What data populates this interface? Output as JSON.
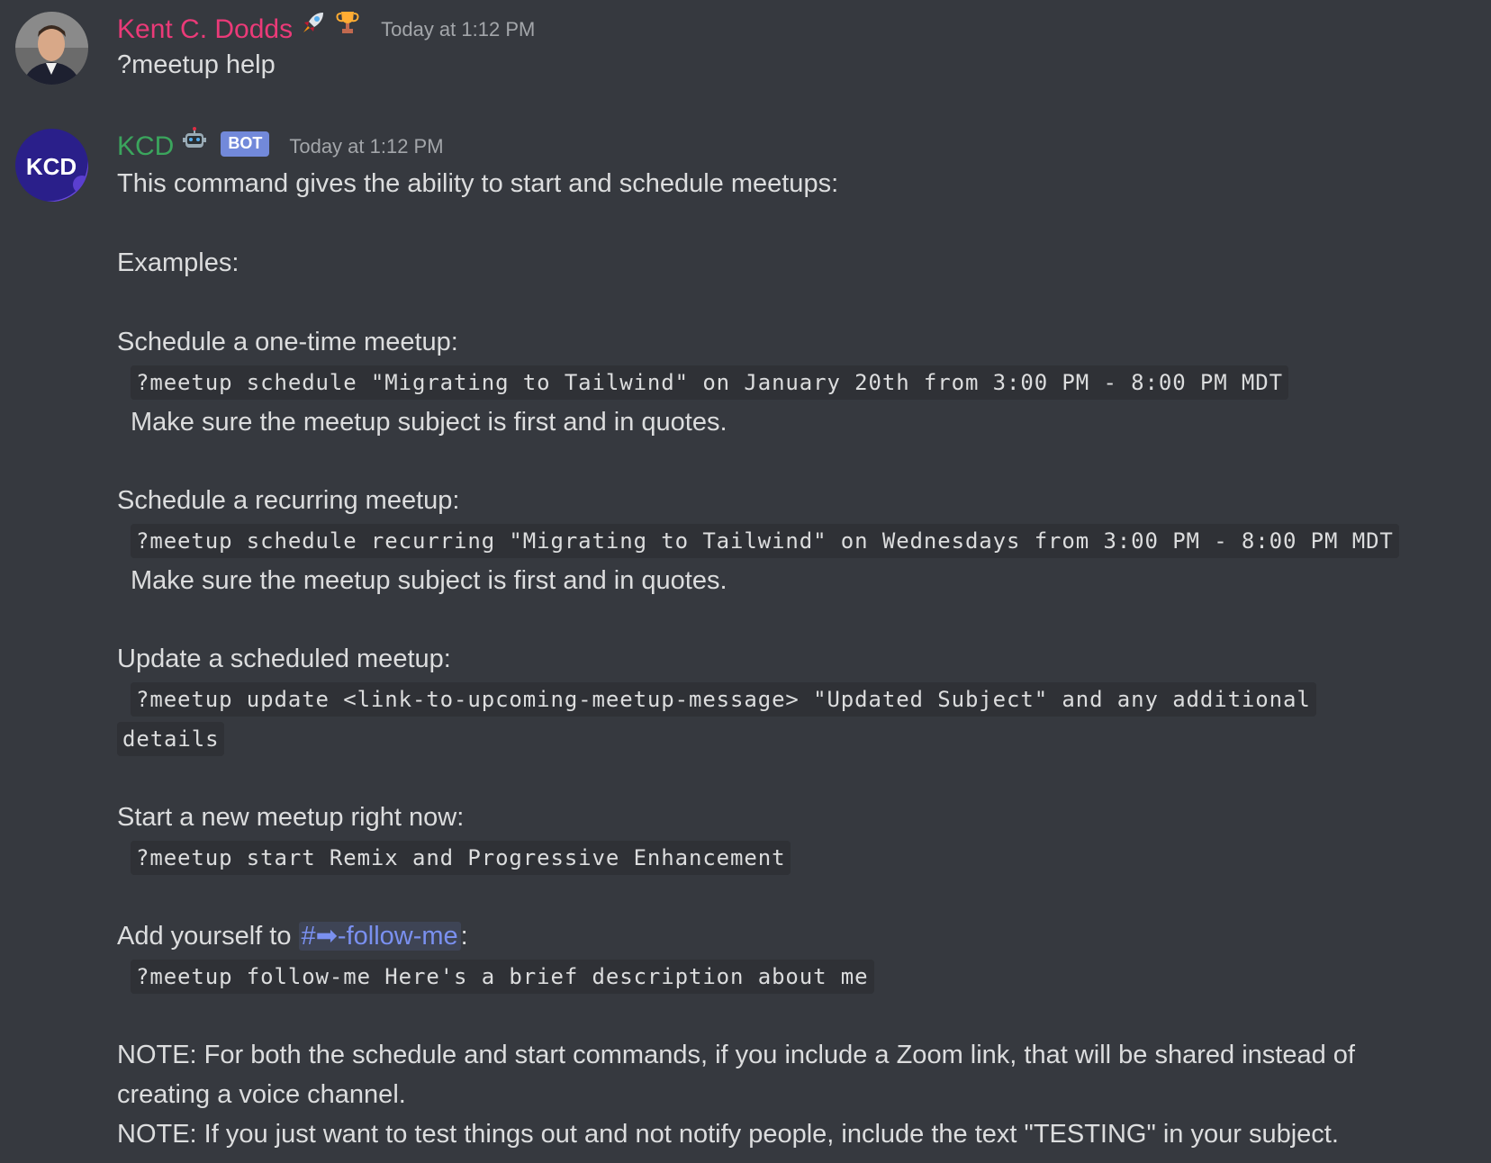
{
  "messages": [
    {
      "author": "Kent C. Dodds",
      "author_emojis": [
        "rocket-emoji",
        "trophy-emoji"
      ],
      "timestamp": "Today at 1:12 PM",
      "text": "?meetup help"
    },
    {
      "author": "KCD",
      "author_emoji": "robot-emoji",
      "bot_tag": "BOT",
      "timestamp": "Today at 1:12 PM",
      "avatar_text": "KCD",
      "intro": "This command gives the ability to start and schedule meetups:",
      "examples_label": "Examples:",
      "sections": [
        {
          "title": "Schedule a one-time meetup:",
          "code": "?meetup schedule \"Migrating to Tailwind\" on January 20th from 3:00 PM - 8:00 PM MDT",
          "note": "Make sure the meetup subject is first and in quotes."
        },
        {
          "title": "Schedule a recurring meetup:",
          "code": "?meetup schedule recurring \"Migrating to Tailwind\" on Wednesdays from 3:00 PM - 8:00 PM MDT",
          "note": "Make sure the meetup subject is first and in quotes."
        },
        {
          "title": "Update a scheduled meetup:",
          "code_line1": "?meetup update <link-to-upcoming-meetup-message> \"Updated Subject\" and any additional",
          "code_line2": "details"
        },
        {
          "title": "Start a new meetup right now:",
          "code": "?meetup start Remix and Progressive Enhancement"
        },
        {
          "title_prefix": "Add yourself to ",
          "channel_mention": "#➡-follow-me",
          "title_suffix": ":",
          "code": "?meetup follow-me Here's a brief description about me"
        }
      ],
      "note1_line1": "NOTE: For both the schedule and start commands, if you include a Zoom link, that will be shared instead of",
      "note1_line2": "creating a voice channel.",
      "note2": "NOTE: If you just want to test things out and not notify people, include the text \"TESTING\" in your subject."
    }
  ],
  "colors": {
    "background": "#36393f",
    "code_background": "#2f3136",
    "kent_name": "#eb3a78",
    "kcd_name": "#3ba55d",
    "bot_tag": "#7289da",
    "mention": "#7a90f0",
    "timestamp": "#a3a6aa"
  }
}
